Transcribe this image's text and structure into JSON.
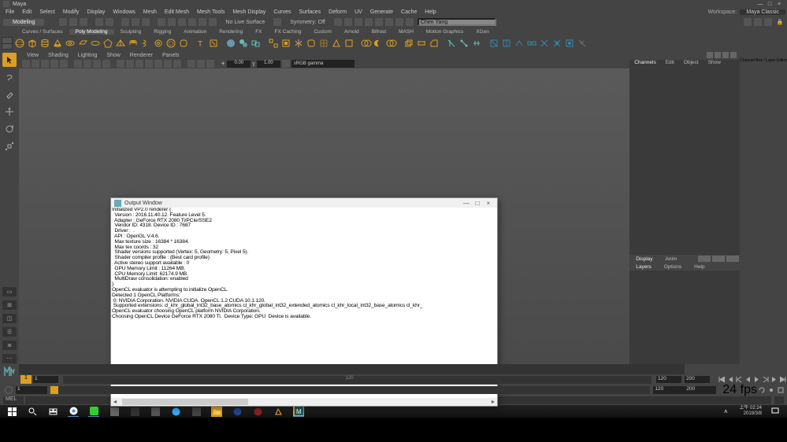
{
  "app": {
    "title": "Maya"
  },
  "window_controls": {
    "min": "—",
    "max": "□",
    "close": "×"
  },
  "menu": [
    "File",
    "Edit",
    "Select",
    "Modify",
    "Display",
    "Windows",
    "Mesh",
    "Edit Mesh",
    "Mesh Tools",
    "Mesh Display",
    "Curves",
    "Surfaces",
    "Deform",
    "UV",
    "Generate",
    "Cache",
    "Help"
  ],
  "workspace": {
    "label": "Workspace:",
    "value": "Maya Classic"
  },
  "status": {
    "module": "Modeling",
    "live_surface": "No Live Surface",
    "symmetry": "Symmetry: Off",
    "name_value": "Chen Yang"
  },
  "shelf_tabs": [
    "Curves / Surfaces",
    "Poly Modeling",
    "Sculpting",
    "Rigging",
    "Animation",
    "Rendering",
    "FX",
    "FX Caching",
    "Custom",
    "Arnold",
    "Bifrost",
    "MASH",
    "Motion Graphics",
    "XGen"
  ],
  "shelf_active_tab": "Poly Modeling",
  "viewport_menu": [
    "View",
    "Shading",
    "Lighting",
    "Show",
    "Renderer",
    "Panels"
  ],
  "viewport_toolbar": {
    "exposure": "0.00",
    "gamma": "1.00",
    "colorspace": "sRGB gamma"
  },
  "right_panel": {
    "tabs": [
      "Channels",
      "Edit",
      "Object",
      "Show"
    ],
    "display_tabs": [
      "Display",
      "Anim"
    ],
    "lower_tabs": [
      "Layers",
      "Options",
      "Help"
    ],
    "collapse": "Channel Box / Layer Editor"
  },
  "output_window": {
    "title": "Output Window",
    "content": "Initialized VP2.0 renderer {\n  Version : 2016.11.40.12. Feature Level 5.\n  Adapter : GeForce RTX 2080 Ti/PCIe/SSE2\n  Vendor ID: 4318. Device ID : 7687\n  Driver :  .\n  API : OpenGL V.4.6.\n  Max texture size : 16384 * 16384.\n  Max tex coords : 32\n  Shader versions supported (Vertex: 5, Geometry: 5, Pixel 5).\n  Shader compiler profile : (Best card profile)\n  Active stereo support available : 0\n  GPU Memory Limit : 11264 MB.\n  CPU Memory Limit: 62174.9 MB.\n  MultiDraw consolidation: enabled\n}\nOpenCL evaluator is attempting to initialize OpenCL.\nDetected 1 OpenCL Platforms:\n 0: NVIDIA Corporation. NVIDIA CUDA. OpenCL 1.2 CUDA 10.1.120.\n Supported extensions: cl_khr_global_int32_base_atomics cl_khr_global_int32_extended_atomics cl_khr_local_int32_base_atomics cl_khr_\nOpenCL evaluator choosing OpenCL platform NVIDIA Corporation.\nChoosing OpenCL Device GeForce RTX 2080 Ti.  Device Type: GPU  Device is available."
  },
  "timeline": {
    "current_frame": "1",
    "start": "1",
    "end_marker": "120",
    "range_start": "1",
    "range_end": "120",
    "scene_end": "200",
    "fps": "24 fps"
  },
  "cmd": {
    "prompt": "MEL"
  },
  "taskbar": {
    "time": "上午 02:24",
    "date": "2019/3/8"
  },
  "colors": {
    "bg_dark": "#444444",
    "bg_darker": "#333333",
    "accent": "#DB9F22",
    "teal": "#5EAAA8"
  }
}
